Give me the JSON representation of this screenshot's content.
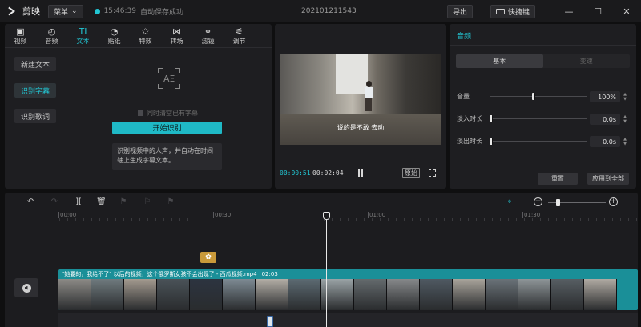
{
  "titlebar": {
    "app_name": "剪映",
    "menu_label": "菜单",
    "save_time": "15:46:39",
    "save_status": "自动保存成功",
    "project_name": "202101211543",
    "export_label": "导出",
    "shortcut_label": "快捷键",
    "minimize": "—",
    "maximize": "☐",
    "close": "✕"
  },
  "toolbar": {
    "items": [
      {
        "icon": "video-icon",
        "glyph": "▣",
        "label": "视频"
      },
      {
        "icon": "audio-icon",
        "glyph": "◴",
        "label": "音频"
      },
      {
        "icon": "text-icon",
        "glyph": "TI",
        "label": "文本"
      },
      {
        "icon": "sticker-icon",
        "glyph": "◔",
        "label": "贴纸"
      },
      {
        "icon": "effects-icon",
        "glyph": "✩",
        "label": "特效"
      },
      {
        "icon": "transition-icon",
        "glyph": "⋈",
        "label": "转场"
      },
      {
        "icon": "filter-icon",
        "glyph": "⚭",
        "label": "滤镜"
      },
      {
        "icon": "adjust-icon",
        "glyph": "⚟",
        "label": "调节"
      }
    ],
    "active_index": 2
  },
  "text_panel": {
    "side_buttons": [
      "新建文本",
      "识别字幕",
      "识别歌词"
    ],
    "active_side": 1,
    "icon_text": "AΞ",
    "checkbox_label": "同时清空已有字幕",
    "start_button": "开始识别",
    "info_text": "识别视频中的人声，并自动在时间轴上生成字幕文本。"
  },
  "preview": {
    "caption": "说的是不敢 去动",
    "current_time": "00:00:51",
    "total_time": "00:02:04",
    "ratio_label": "原始"
  },
  "properties": {
    "title": "音频",
    "tabs": [
      "基本",
      "变速"
    ],
    "active_tab": 0,
    "rows": [
      {
        "label": "音量",
        "value": "100%",
        "level": 0.45
      },
      {
        "label": "淡入时长",
        "value": "0.0s",
        "level": 0.0
      },
      {
        "label": "淡出时长",
        "value": "0.0s",
        "level": 0.0
      }
    ],
    "reset_label": "重置",
    "apply_all_label": "应用到全部"
  },
  "timeline": {
    "ruler_labels": [
      "00:00",
      "00:30",
      "01:00",
      "01:30"
    ],
    "zoom_level": 0.15,
    "clip_name": "\"她要的，我给不了\" 以后的视频，这个俄罗斯女孩不会出现了 - 西瓜视频.mp4",
    "clip_duration": "02:03",
    "accent": "#22c6d3",
    "clip_color": "#1a8f98"
  }
}
